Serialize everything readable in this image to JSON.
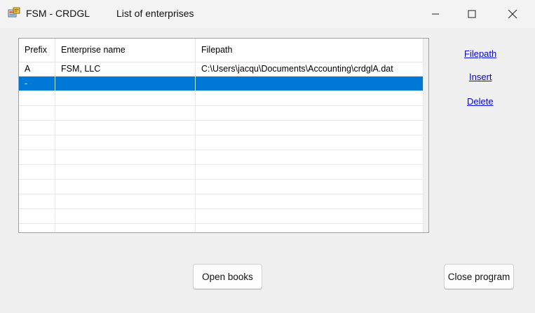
{
  "window": {
    "app_title": "FSM - CRDGL",
    "subtitle": "List of enterprises",
    "controls": [
      "minimize-icon",
      "maximize-icon",
      "close-icon"
    ]
  },
  "grid": {
    "columns": [
      "Prefix",
      "Enterprise name",
      "Filepath"
    ],
    "rows": [
      [
        "A",
        "FSM, LLC",
        "C:\\Users\\jacqu\\Documents\\Accounting\\crdglA.dat"
      ],
      [
        "-",
        "",
        ""
      ]
    ],
    "selected_row_index": 1,
    "selection_color": "#0078d7"
  },
  "links": {
    "filepath": "Filepath",
    "insert": "Insert",
    "delete": "Delete"
  },
  "buttons": {
    "open_books": "Open books",
    "close_program": "Close program"
  }
}
